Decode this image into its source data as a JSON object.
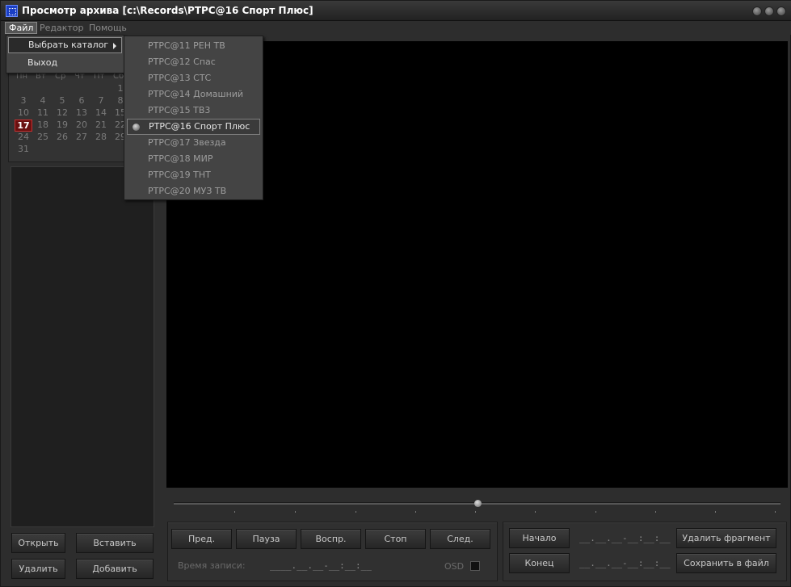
{
  "window": {
    "title": "Просмотр архива [c:\\Records\\РТРС@16 Спорт Плюс]"
  },
  "menubar": {
    "items": [
      {
        "label": "Файл"
      },
      {
        "label": "Редактор"
      },
      {
        "label": "Помощь"
      }
    ]
  },
  "file_menu": {
    "items": [
      {
        "label": "Выбрать каталог",
        "has_submenu": true
      },
      {
        "label": "Выход"
      }
    ]
  },
  "catalog_submenu": {
    "items": [
      {
        "label": "РТРС@11 РЕН ТВ"
      },
      {
        "label": "РТРС@12 Спас"
      },
      {
        "label": "РТРС@13 СТС"
      },
      {
        "label": "РТРС@14 Домашний"
      },
      {
        "label": "РТРС@15 ТВ3"
      },
      {
        "label": "РТРС@16 Спорт Плюс",
        "selected": true
      },
      {
        "label": "РТРС@17 Звезда"
      },
      {
        "label": "РТРС@18 МИР"
      },
      {
        "label": "РТРС@19 ТНТ"
      },
      {
        "label": "РТРС@20 МУЗ ТВ"
      }
    ]
  },
  "calendar": {
    "weekdays": [
      "Пн",
      "Вт",
      "Ср",
      "Чт",
      "Пт",
      "Сб"
    ],
    "rows": [
      [
        "",
        "",
        "",
        "",
        "",
        "1"
      ],
      [
        "3",
        "4",
        "5",
        "6",
        "7",
        "8"
      ],
      [
        "10",
        "11",
        "12",
        "13",
        "14",
        "15"
      ],
      [
        "17",
        "18",
        "19",
        "20",
        "21",
        "22"
      ],
      [
        "24",
        "25",
        "26",
        "27",
        "28",
        "29"
      ],
      [
        "31",
        "",
        "",
        "",
        "",
        ""
      ]
    ],
    "today": "17"
  },
  "left_buttons": {
    "open": "Открыть",
    "insert": "Вставить",
    "delete": "Удалить",
    "add": "Добавить"
  },
  "playback": {
    "prev": "Пред.",
    "pause": "Пауза",
    "play": "Воспр.",
    "stop": "Стоп",
    "next": "След.",
    "record_time_label": "Время записи:",
    "record_time_value": "____.__.__-__:__:__",
    "osd_label": "OSD",
    "seek_position": 0.5
  },
  "fragment": {
    "start": "Начало",
    "end": "Конец",
    "start_time": "__.__.__-__:__:__",
    "end_time": "__.__.__-__:__:__",
    "delete_fragment": "Удалить фрагмент",
    "save_to_file": "Сохранить в файл"
  },
  "colors": {
    "background": "#2d2d2d",
    "video": "#000000",
    "today_highlight": "#6a1010",
    "title_icon": "#1b3fc4"
  }
}
